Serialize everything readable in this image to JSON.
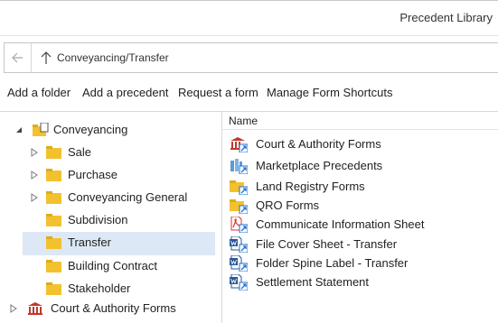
{
  "window": {
    "title": "Precedent Library"
  },
  "address": {
    "path": "Conveyancing/Transfer"
  },
  "toolbar": {
    "add_folder": "Add a folder",
    "add_precedent": "Add a precedent",
    "request_form": "Request a form",
    "manage_shortcuts": "Manage Form Shortcuts"
  },
  "tree": {
    "root": "Conveyancing",
    "items": [
      {
        "label": "Sale",
        "expandable": true
      },
      {
        "label": "Purchase",
        "expandable": true
      },
      {
        "label": "Conveyancing General",
        "expandable": true
      },
      {
        "label": "Subdivision",
        "expandable": false
      },
      {
        "label": "Transfer",
        "expandable": false,
        "selected": true
      },
      {
        "label": "Building Contract",
        "expandable": false
      },
      {
        "label": "Stakeholder",
        "expandable": false
      }
    ],
    "sibling": "Court & Authority Forms"
  },
  "list": {
    "column_name": "Name",
    "items": [
      {
        "label": "Court & Authority Forms",
        "icon": "court-shortcut-icon"
      },
      {
        "label": "Marketplace Precedents",
        "icon": "marketplace-shortcut-icon"
      },
      {
        "label": "Land Registry Forms",
        "icon": "folder-shortcut-icon"
      },
      {
        "label": "QRO Forms",
        "icon": "folder-shortcut-icon"
      },
      {
        "label": "Communicate Information Sheet",
        "icon": "pdf-shortcut-icon"
      },
      {
        "label": "File Cover Sheet - Transfer",
        "icon": "word-shortcut-icon"
      },
      {
        "label": "Folder Spine Label - Transfer",
        "icon": "word-shortcut-icon"
      },
      {
        "label": "Settlement Statement",
        "icon": "word-shortcut-icon"
      }
    ]
  },
  "colors": {
    "folder": "#f2c12e",
    "selection": "#dce8f5",
    "shortcut_arrow": "#1e6fd0",
    "word": "#2b5797",
    "pdf": "#d9342b",
    "court": "#c0392b"
  }
}
